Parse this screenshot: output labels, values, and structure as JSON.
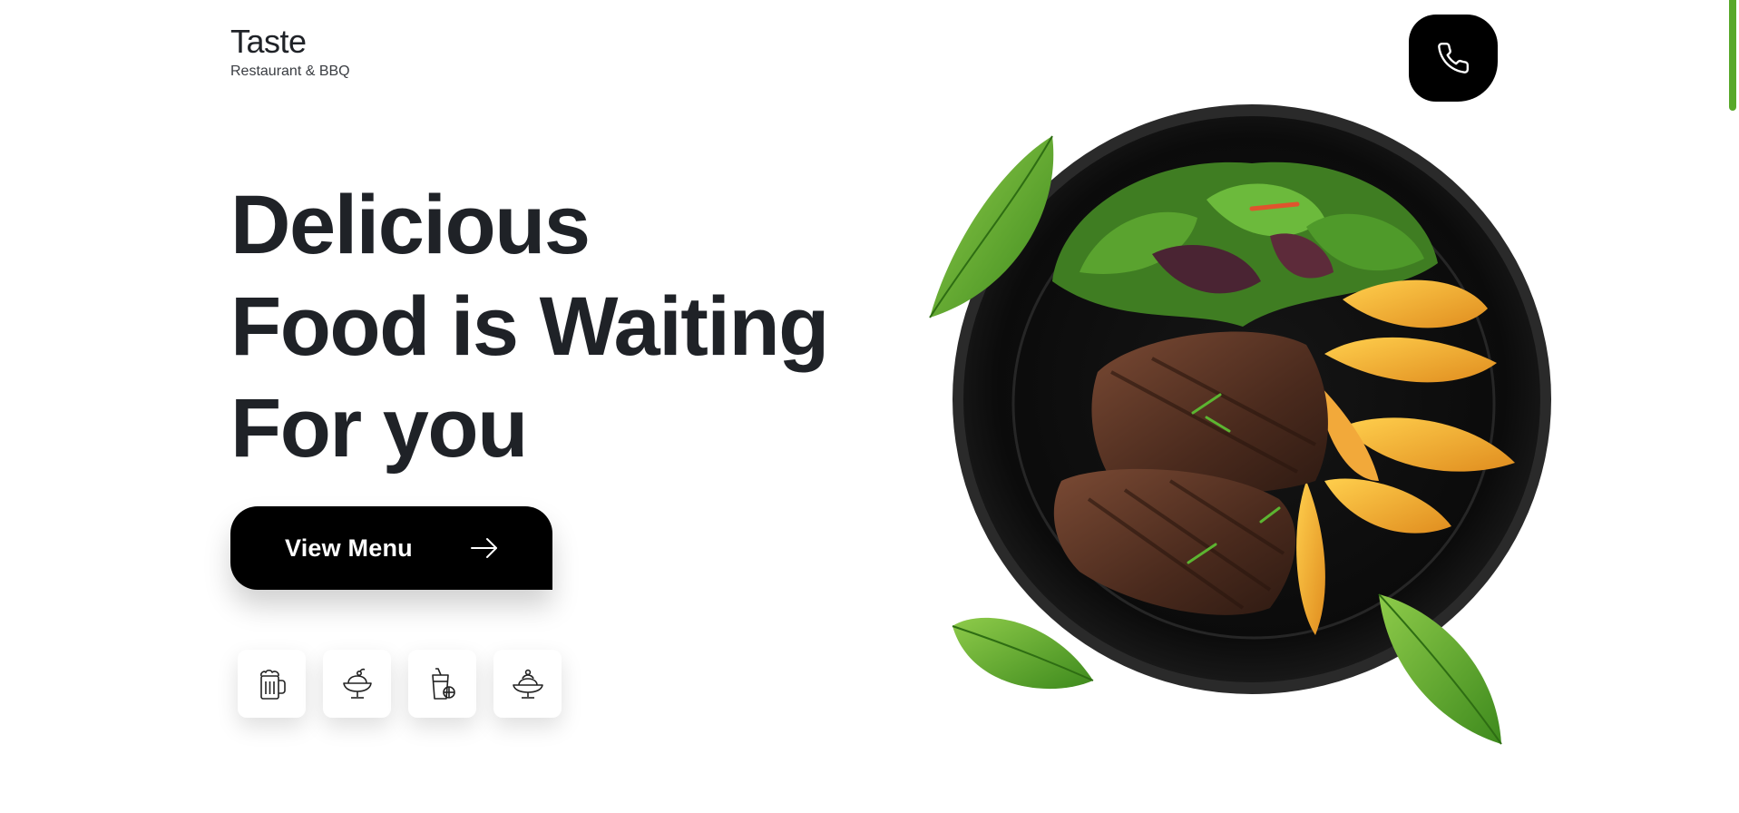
{
  "brand": {
    "name": "Taste",
    "tagline": "Restaurant & BBQ"
  },
  "header": {
    "call_icon": "phone-icon"
  },
  "hero": {
    "title_lines": [
      "Delicious",
      "Food is Waiting",
      "For you"
    ],
    "cta_label": "View Menu",
    "cta_icon": "arrow-right-icon"
  },
  "categories": [
    {
      "icon": "beer-mug-icon"
    },
    {
      "icon": "ice-cream-sundae-icon"
    },
    {
      "icon": "juice-glass-icon"
    },
    {
      "icon": "dessert-cup-icon"
    }
  ],
  "food_image": {
    "subject": "steak-plate-image"
  },
  "colors": {
    "primary": "#000000",
    "text": "#1f2227",
    "accent": "#58a82a",
    "background": "#ffffff"
  }
}
